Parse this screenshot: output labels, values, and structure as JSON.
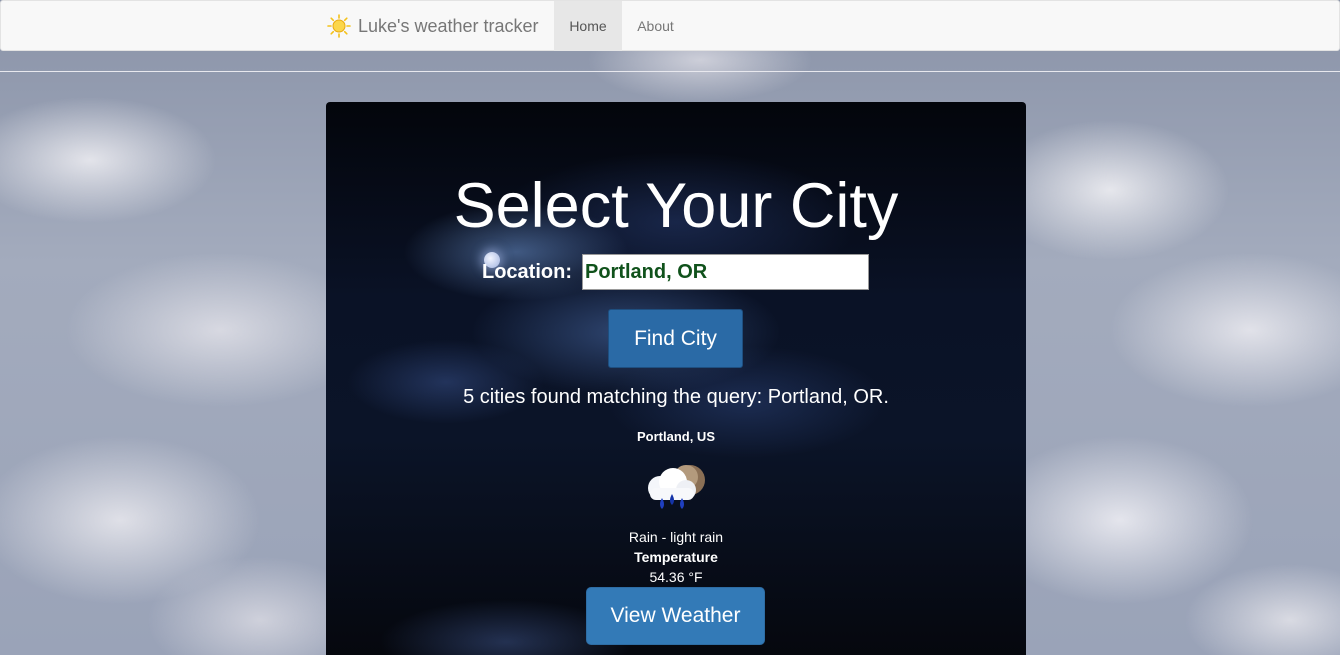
{
  "navbar": {
    "brand": "Luke's weather tracker",
    "brand_icon": "sun-icon",
    "items": [
      {
        "label": "Home",
        "active": true
      },
      {
        "label": "About",
        "active": false
      }
    ]
  },
  "main": {
    "title": "Select Your City",
    "location_label": "Location:",
    "location_value": "Portland, OR",
    "find_button": "Find City",
    "result_message": "5 cities found matching the query: Portland, OR.",
    "result": {
      "city": "Portland, US",
      "weather_icon": "rain-cloud-night-icon",
      "description": "Rain - light rain",
      "temperature_label": "Temperature",
      "temperature_value": "54.36 °F"
    },
    "view_button": "View Weather"
  },
  "colors": {
    "navbar_bg": "#f8f8f8",
    "active_nav_bg": "#e7e7e7",
    "find_button": "#2a6aa6",
    "view_button": "#337ab7",
    "input_text": "#10521b"
  }
}
